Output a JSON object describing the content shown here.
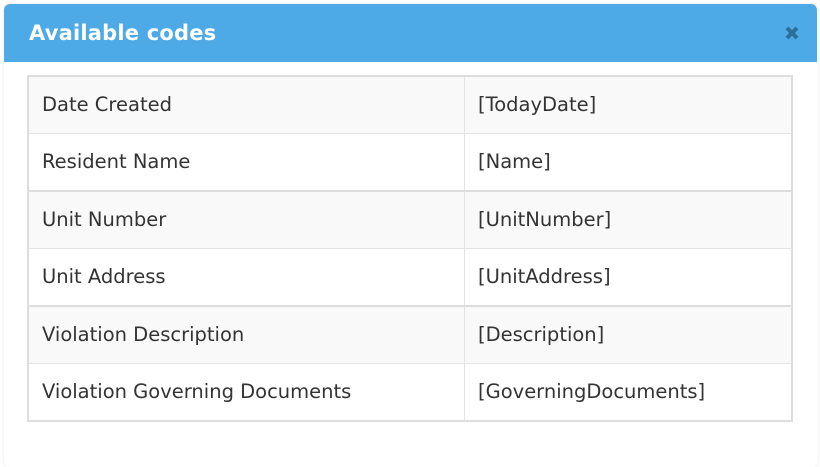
{
  "modal": {
    "title": "Available codes",
    "header_color": "#4eaae6",
    "close_icon": "close-icon"
  },
  "codes": [
    {
      "description": "Date Created",
      "code": "[TodayDate]"
    },
    {
      "description": "Resident Name",
      "code": "[Name]"
    },
    {
      "description": "Unit Number",
      "code": "[UnitNumber]"
    },
    {
      "description": "Unit Address",
      "code": "[UnitAddress]"
    },
    {
      "description": "Violation Description",
      "code": "[Description]"
    },
    {
      "description": "Violation Governing Documents",
      "code": "[GoverningDocuments]"
    }
  ]
}
